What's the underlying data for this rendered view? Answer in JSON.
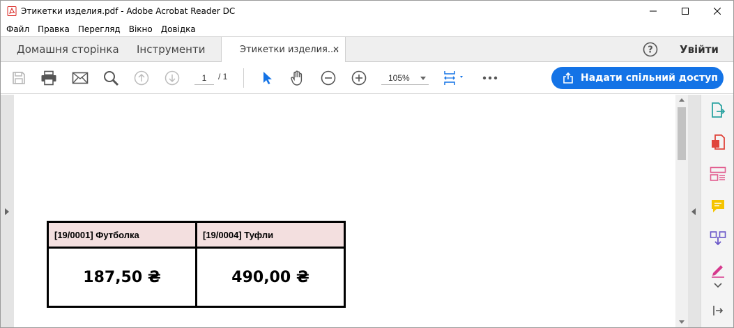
{
  "window": {
    "title": "Этикетки изделия.pdf - Adobe Acrobat Reader DC"
  },
  "menu": {
    "items": [
      "Файл",
      "Правка",
      "Перегляд",
      "Вікно",
      "Довідка"
    ]
  },
  "tabs": {
    "home": "Домашня сторінка",
    "tools": "Інструменти",
    "document": "Этикетки изделия....",
    "sign_in": "Увійти"
  },
  "toolbar": {
    "page_current": "1",
    "page_total": "/ 1",
    "zoom": "105%",
    "share_label": "Надати спільний доступ"
  },
  "document": {
    "labels": [
      {
        "title": "[19/0001] Футболка",
        "price": "187,50 ₴"
      },
      {
        "title": "[19/0004] Туфли",
        "price": "490,00 ₴"
      }
    ]
  },
  "colors": {
    "accent": "#1473e6",
    "label_header_bg": "#f3dfdf",
    "acrobat_red": "#d9231f"
  }
}
